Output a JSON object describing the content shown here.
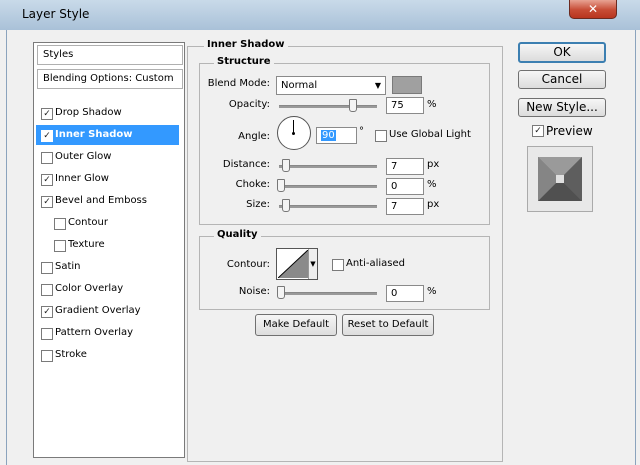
{
  "window": {
    "title": "Layer Style",
    "close_label": "✕"
  },
  "styles_panel": {
    "header": "Styles",
    "blending_options": "Blending Options: Custom",
    "items": [
      {
        "label": "Drop Shadow",
        "checked": true
      },
      {
        "label": "Inner Shadow",
        "checked": true,
        "selected": true
      },
      {
        "label": "Outer Glow",
        "checked": false
      },
      {
        "label": "Inner Glow",
        "checked": true
      },
      {
        "label": "Bevel and Emboss",
        "checked": true
      },
      {
        "label": "Contour",
        "checked": false,
        "indent": true
      },
      {
        "label": "Texture",
        "checked": false,
        "indent": true
      },
      {
        "label": "Satin",
        "checked": false
      },
      {
        "label": "Color Overlay",
        "checked": false
      },
      {
        "label": "Gradient Overlay",
        "checked": true
      },
      {
        "label": "Pattern Overlay",
        "checked": false
      },
      {
        "label": "Stroke",
        "checked": false
      }
    ]
  },
  "inner_shadow": {
    "section_title": "Inner Shadow",
    "structure": {
      "title": "Structure",
      "blend_mode_label": "Blend Mode:",
      "blend_mode_value": "Normal",
      "shadow_color": "#a0a0a0",
      "opacity_label": "Opacity:",
      "opacity_value": "75",
      "opacity_unit": "%",
      "angle_label": "Angle:",
      "angle_value": "90",
      "angle_unit": "°",
      "use_global_light_label": "Use Global Light",
      "use_global_light_checked": false,
      "distance_label": "Distance:",
      "distance_value": "7",
      "distance_unit": "px",
      "choke_label": "Choke:",
      "choke_value": "0",
      "choke_unit": "%",
      "size_label": "Size:",
      "size_value": "7",
      "size_unit": "px"
    },
    "quality": {
      "title": "Quality",
      "contour_label": "Contour:",
      "anti_aliased_label": "Anti-aliased",
      "anti_aliased_checked": false,
      "noise_label": "Noise:",
      "noise_value": "0",
      "noise_unit": "%"
    },
    "make_default_label": "Make Default",
    "reset_default_label": "Reset to Default"
  },
  "actions": {
    "ok_label": "OK",
    "cancel_label": "Cancel",
    "new_style_label": "New Style...",
    "preview_label": "Preview",
    "preview_checked": true
  },
  "colors": {
    "selection": "#3399ff",
    "dialog_bg": "#f0f0f0"
  }
}
